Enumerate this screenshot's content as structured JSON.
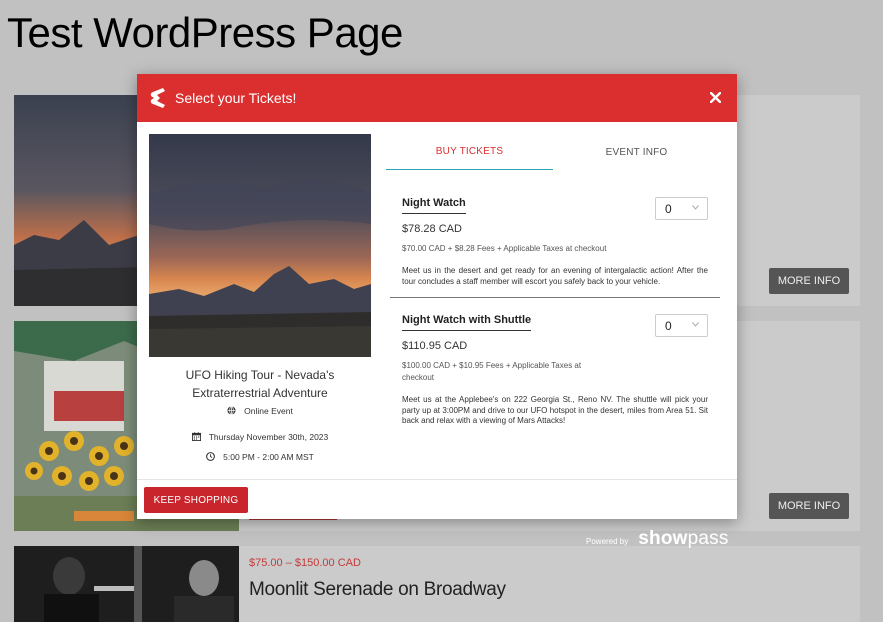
{
  "page": {
    "title": "Test WordPress Page"
  },
  "cards": [
    {
      "more_info": "MORE INFO"
    },
    {
      "more_info": "MORE INFO"
    },
    {
      "price": "$75.00 – $150.00 CAD",
      "name": "Moonlit Serenade on Broadway"
    }
  ],
  "modal": {
    "title": "Select your Tickets!",
    "close_icon": "close-icon",
    "event": {
      "name": "UFO Hiking Tour - Nevada's Extraterrestrial Adventure",
      "location": "Online Event",
      "date": "Thursday November 30th, 2023",
      "time": "5:00 PM - 2:00 AM MST"
    },
    "tabs": [
      {
        "label": "BUY TICKETS",
        "active": true
      },
      {
        "label": "EVENT INFO",
        "active": false
      }
    ],
    "tickets": [
      {
        "name": "Night Watch",
        "price": "$78.28 CAD",
        "fees": "$70.00 CAD + $8.28 Fees + Applicable Taxes at checkout",
        "description": "Meet us in the desert and get ready for an evening of intergalactic action! After the tour concludes a staff member will escort you safely back to your vehicle.",
        "quantity": "0"
      },
      {
        "name": "Night Watch with Shuttle",
        "price": "$110.95 CAD",
        "fees": "$100.00 CAD + $10.95 Fees + Applicable Taxes at checkout",
        "description": "Meet us at the Applebee's on 222 Georgia St., Reno NV. The shuttle will pick your party up at 3:00PM and drive to our UFO hotspot in the desert, miles from Area 51. Sit back and relax with a viewing of Mars Attacks!",
        "quantity": "0"
      }
    ],
    "keep_shopping": "KEEP SHOPPING"
  },
  "powered_by": {
    "label": "Powered by",
    "brand_bold": "show",
    "brand_thin": "pass"
  },
  "colors": {
    "header_red": "#db2f2f",
    "button_red": "#c8262c",
    "tab_underline": "#2fa4b8"
  }
}
